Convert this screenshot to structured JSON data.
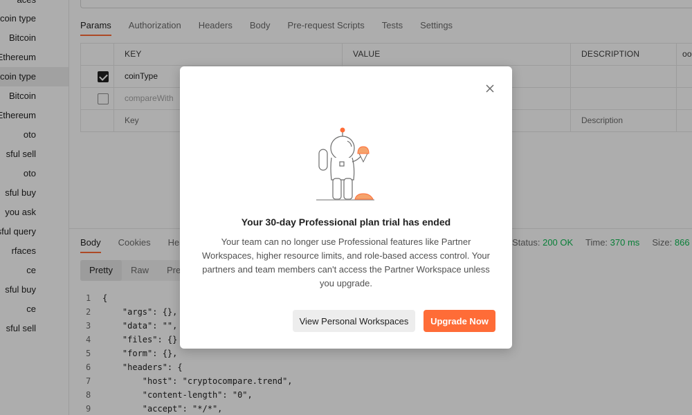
{
  "sidebar": {
    "items": [
      {
        "label": "aces"
      },
      {
        "label": "coin type"
      },
      {
        "label": "Bitcoin"
      },
      {
        "label": "e Ethereum"
      },
      {
        "label": "coin type"
      },
      {
        "label": "Bitcoin"
      },
      {
        "label": "Ethereum"
      },
      {
        "label": "oto"
      },
      {
        "label": "sful sell"
      },
      {
        "label": "oto"
      },
      {
        "label": "sful buy"
      },
      {
        "label": "you ask"
      },
      {
        "label": "sful query"
      },
      {
        "label": "rfaces"
      },
      {
        "label": "ce"
      },
      {
        "label": "sful buy"
      },
      {
        "label": "ce"
      },
      {
        "label": "sful sell"
      }
    ]
  },
  "request": {
    "tabs": [
      {
        "label": "Params"
      },
      {
        "label": "Authorization"
      },
      {
        "label": "Headers"
      },
      {
        "label": "Body"
      },
      {
        "label": "Pre-request Scripts"
      },
      {
        "label": "Tests"
      },
      {
        "label": "Settings"
      }
    ],
    "params": {
      "headers": {
        "key": "KEY",
        "value": "VALUE",
        "description": "DESCRIPTION",
        "more": "ooo"
      },
      "rows": [
        {
          "checked": true,
          "key": "coinType"
        },
        {
          "checked": false,
          "key": "compareWith"
        }
      ],
      "placeholder_key": "Key",
      "placeholder_description": "Description"
    }
  },
  "response": {
    "tabs": [
      {
        "label": "Body"
      },
      {
        "label": "Cookies"
      },
      {
        "label": "Hea"
      }
    ],
    "status_label": "Status:",
    "status_value": "200 OK",
    "time_label": "Time:",
    "time_value": "370 ms",
    "size_label": "Size:",
    "size_value": "866 B",
    "format_tabs": [
      {
        "label": "Pretty"
      },
      {
        "label": "Raw"
      },
      {
        "label": "Prev"
      }
    ],
    "code_lines": [
      {
        "n": "1",
        "text": "{"
      },
      {
        "n": "2",
        "text": "    \"args\": {},"
      },
      {
        "n": "3",
        "text": "    \"data\": \"\","
      },
      {
        "n": "4",
        "text": "    \"files\": {}"
      },
      {
        "n": "5",
        "text": "    \"form\": {},"
      },
      {
        "n": "6",
        "text": "    \"headers\": {"
      },
      {
        "n": "7",
        "text": "        \"host\": \"cryptocompare.trend\","
      },
      {
        "n": "8",
        "text": "        \"content-length\": \"0\","
      },
      {
        "n": "9",
        "text": "        \"accept\": \"*/*\","
      }
    ]
  },
  "modal": {
    "title": "Your 30-day Professional plan trial has ended",
    "body": "Your team can no longer use Professional features like Partner Workspaces, higher resource limits, and role-based access control. Your partners and team members can't access the Partner Workspace unless you upgrade.",
    "secondary_button": "View Personal Workspaces",
    "primary_button": "Upgrade Now",
    "close_icon": "close-icon",
    "illustration": "astronaut-ice-cream-illustration"
  },
  "colors": {
    "accent": "#ff6c37",
    "status_ok": "#0cbb52",
    "overlay": "rgba(0,0,0,0.32)"
  }
}
